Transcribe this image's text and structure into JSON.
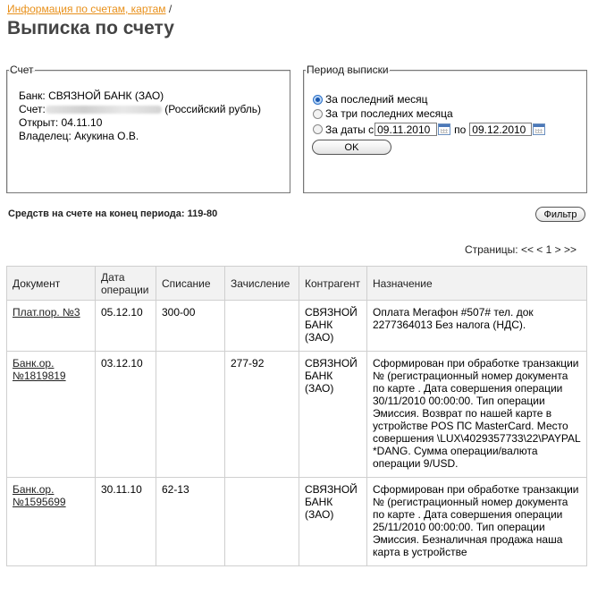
{
  "breadcrumb": {
    "link": "Информация по счетам, картам",
    "separator": "/"
  },
  "page_title": "Выписка по счету",
  "account": {
    "legend": "Счет",
    "bank_line": "Банк: СВЯЗНОЙ БАНК (ЗАО)",
    "account_prefix": "Счет:",
    "currency_suffix": "(Российский рубль)",
    "opened_line": "Открыт: 04.11.10",
    "owner_line": "Владелец: Акукина О.В."
  },
  "period": {
    "legend": "Период выписки",
    "options": [
      "За последний месяц",
      "За три последних месяца",
      "За даты с"
    ],
    "selected_index": 0,
    "date_from": "09.11.2010",
    "to_label": "по",
    "date_to": "09.12.2010",
    "ok_label": "OK"
  },
  "balance_text": "Средств на счете на конец периода: 119-80",
  "filter_label": "Фильтр",
  "pager_text": "Страницы: << < 1 > >>",
  "table": {
    "headers": [
      "Документ",
      "Дата операции",
      "Списание",
      "Зачисление",
      "Контрагент",
      "Назначение"
    ],
    "rows": [
      {
        "doc": "Плат.пор. №3",
        "date": "05.12.10",
        "debit": "300-00",
        "credit": "",
        "counterparty": "СВЯЗНОЙ БАНК (ЗАО)",
        "purpose": "Оплата Мегафон #507# тел. док 2277364013 Без налога (НДС)."
      },
      {
        "doc": "Банк.ор. №1819819",
        "date": "03.12.10",
        "debit": "",
        "credit": "277-92",
        "counterparty": "СВЯЗНОЙ БАНК (ЗАО)",
        "purpose": "Сформирован при обработке транзакции № (регистрационный номер документа по карте . Дата совершения операции 30/11/2010 00:00:00. Тип операции Эмиссия. Возврат по нашей карте в устройстве POS ПС MasterCard. Место совершения \\LUX\\4029357733\\22\\PAYPAL *DANG. Сумма операции/валюта операции 9/USD."
      },
      {
        "doc": "Банк.ор. №1595699",
        "date": "30.11.10",
        "debit": "62-13",
        "credit": "",
        "counterparty": "СВЯЗНОЙ БАНК (ЗАО)",
        "purpose": "Сформирован при обработке транзакции № (регистрационный номер документа по карте . Дата совершения операции 25/11/2010 00:00:00. Тип операции Эмиссия. Безналичная продажа наша карта в устройстве"
      }
    ]
  }
}
